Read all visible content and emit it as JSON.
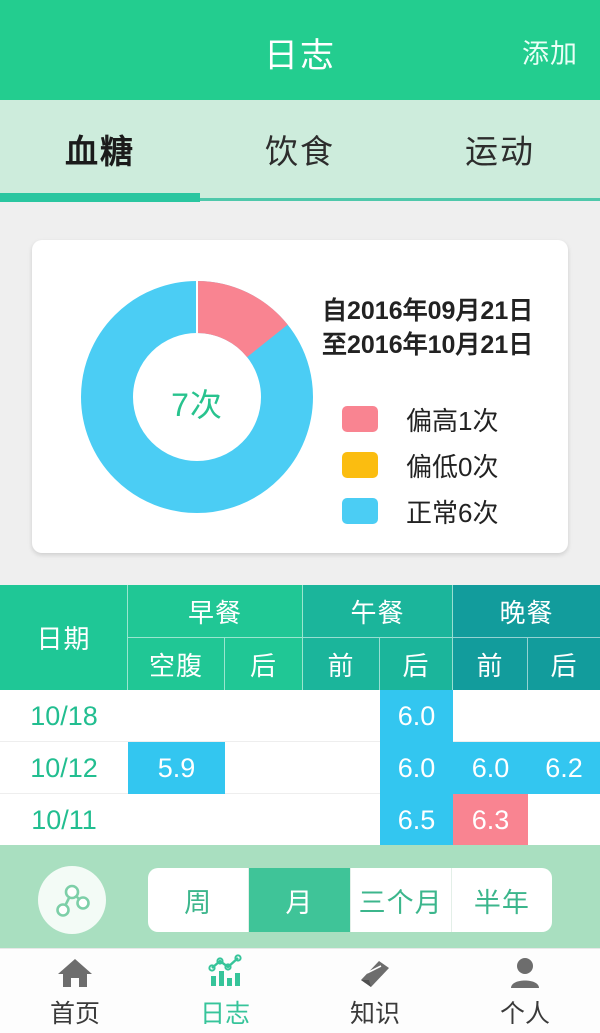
{
  "header": {
    "title": "日志",
    "action_label": "添加",
    "bg_color": "#23cd8f"
  },
  "tabs": [
    {
      "label": "血糖",
      "active": true
    },
    {
      "label": "饮食",
      "active": false
    },
    {
      "label": "运动",
      "active": false
    }
  ],
  "summary_card": {
    "center_label": "7次",
    "date_range_line1": "自2016年09月21日",
    "date_range_line2": "至2016年10月21日",
    "legend": [
      {
        "label": "偏高1次",
        "color": "#f98491"
      },
      {
        "label": "偏低0次",
        "color": "#fbbd10"
      },
      {
        "label": "正常6次",
        "color": "#4bcdf4"
      }
    ]
  },
  "chart_data": {
    "type": "pie",
    "title": "7次",
    "subtitle": "自2016年09月21日 至2016年10月21日",
    "categories": [
      "偏高",
      "偏低",
      "正常"
    ],
    "values": [
      1,
      0,
      6
    ],
    "total": 7,
    "unit": "次",
    "colors": [
      "#f98491",
      "#fbbd10",
      "#4bcdf4"
    ],
    "legend_position": "right",
    "donut": true,
    "inner_radius_ratio": 0.56,
    "start_angle_deg": 0,
    "legend_entries": [
      "偏高1次",
      "偏低0次",
      "正常6次"
    ]
  },
  "table": {
    "date_header": "日期",
    "groups": [
      {
        "label": "早餐",
        "color": "#20c795",
        "subs": [
          "空腹",
          "后"
        ]
      },
      {
        "label": "午餐",
        "color": "#1bb59b",
        "subs": [
          "前",
          "后"
        ]
      },
      {
        "label": "晚餐",
        "color": "#129c9c",
        "subs": [
          "前",
          "后"
        ]
      }
    ],
    "rows": [
      {
        "date": "10/18",
        "cells": [
          {
            "value": "",
            "state": "empty"
          },
          {
            "value": "",
            "state": "empty"
          },
          {
            "value": "",
            "state": "empty"
          },
          {
            "value": "6.0",
            "state": "normal"
          },
          {
            "value": "",
            "state": "empty"
          },
          {
            "value": "",
            "state": "empty"
          }
        ]
      },
      {
        "date": "10/12",
        "cells": [
          {
            "value": "5.9",
            "state": "normal"
          },
          {
            "value": "",
            "state": "empty"
          },
          {
            "value": "",
            "state": "empty"
          },
          {
            "value": "6.0",
            "state": "normal"
          },
          {
            "value": "6.0",
            "state": "normal"
          },
          {
            "value": "6.2",
            "state": "normal"
          }
        ]
      },
      {
        "date": "10/11",
        "cells": [
          {
            "value": "",
            "state": "empty"
          },
          {
            "value": "",
            "state": "empty"
          },
          {
            "value": "",
            "state": "empty"
          },
          {
            "value": "6.5",
            "state": "normal"
          },
          {
            "value": "6.3",
            "state": "high"
          },
          {
            "value": "",
            "state": "empty"
          }
        ]
      }
    ]
  },
  "filter_bar": {
    "graph_icon": "node-graph-icon",
    "segments": [
      {
        "label": "周",
        "selected": false
      },
      {
        "label": "月",
        "selected": true
      },
      {
        "label": "三个月",
        "selected": false
      },
      {
        "label": "半年",
        "selected": false
      }
    ]
  },
  "bottom_nav": [
    {
      "label": "首页",
      "icon": "home-icon",
      "active": false
    },
    {
      "label": "日志",
      "icon": "chart-log-icon",
      "active": true
    },
    {
      "label": "知识",
      "icon": "book-icon",
      "active": false
    },
    {
      "label": "个人",
      "icon": "person-icon",
      "active": false
    }
  ]
}
